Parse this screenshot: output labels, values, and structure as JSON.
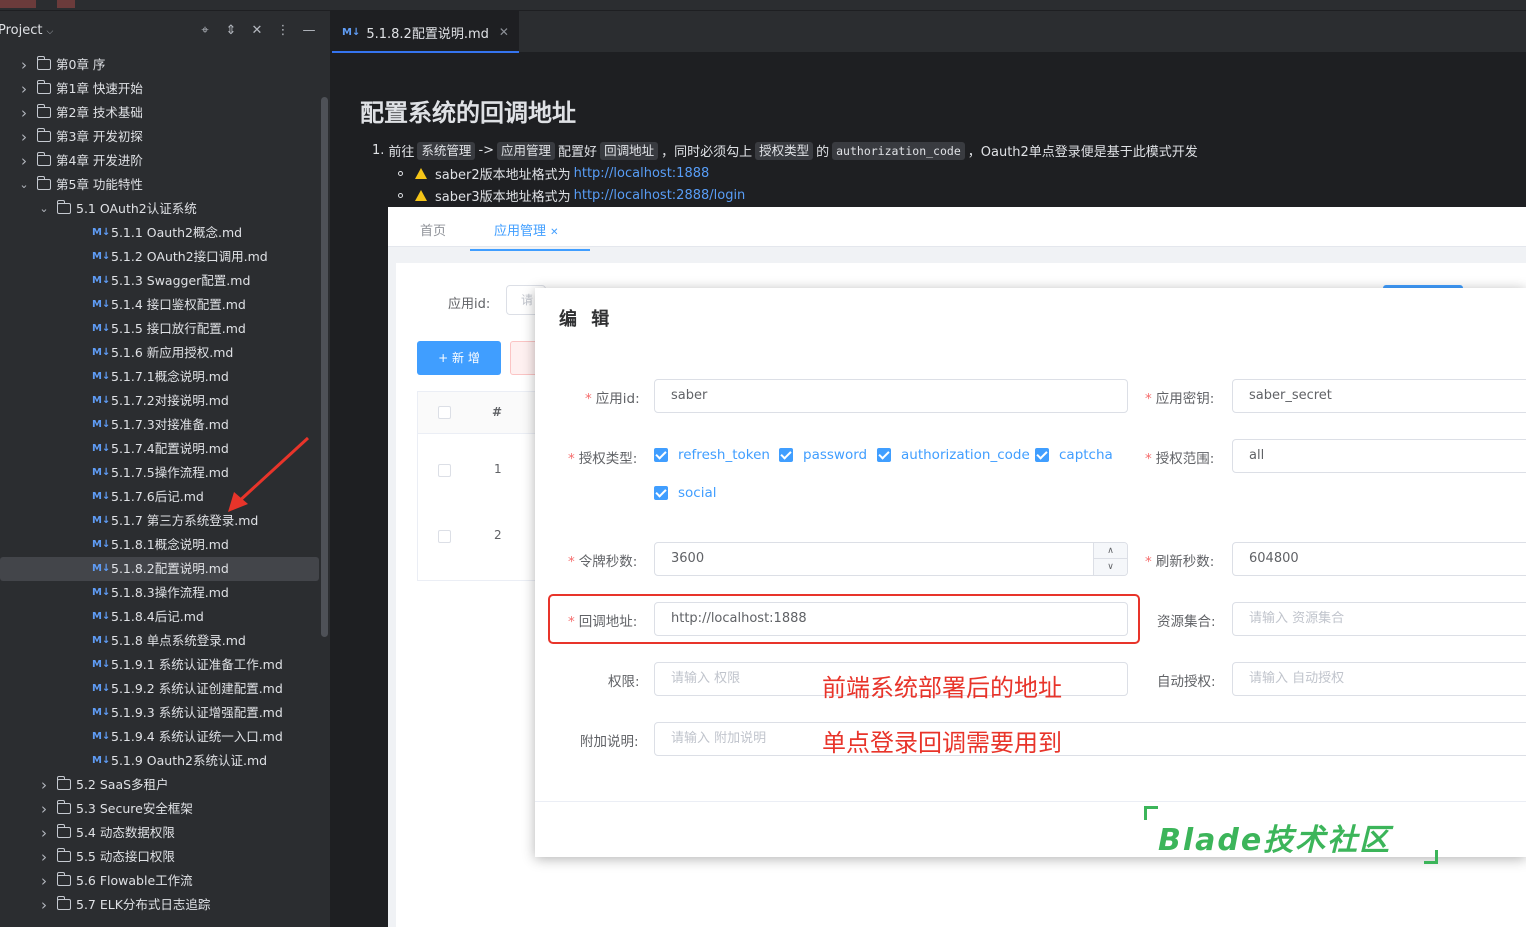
{
  "project": {
    "title": "Project",
    "tree": [
      {
        "label": "第0章 序",
        "type": "folder",
        "depth": 0,
        "expanded": false
      },
      {
        "label": "第1章 快速开始",
        "type": "folder",
        "depth": 0,
        "expanded": false
      },
      {
        "label": "第2章 技术基础",
        "type": "folder",
        "depth": 0,
        "expanded": false
      },
      {
        "label": "第3章 开发初探",
        "type": "folder",
        "depth": 0,
        "expanded": false
      },
      {
        "label": "第4章 开发进阶",
        "type": "folder",
        "depth": 0,
        "expanded": false
      },
      {
        "label": "第5章 功能特性",
        "type": "folder",
        "depth": 0,
        "expanded": true
      },
      {
        "label": "5.1 OAuth2认证系统",
        "type": "folder",
        "depth": 1,
        "expanded": true
      },
      {
        "label": "5.1.1 Oauth2概念.md",
        "type": "md",
        "depth": 2
      },
      {
        "label": "5.1.2 OAuth2接口调用.md",
        "type": "md",
        "depth": 2
      },
      {
        "label": "5.1.3 Swagger配置.md",
        "type": "md",
        "depth": 2
      },
      {
        "label": "5.1.4 接口鉴权配置.md",
        "type": "md",
        "depth": 2
      },
      {
        "label": "5.1.5 接口放行配置.md",
        "type": "md",
        "depth": 2
      },
      {
        "label": "5.1.6 新应用授权.md",
        "type": "md",
        "depth": 2
      },
      {
        "label": "5.1.7.1概念说明.md",
        "type": "md",
        "depth": 2
      },
      {
        "label": "5.1.7.2对接说明.md",
        "type": "md",
        "depth": 2
      },
      {
        "label": "5.1.7.3对接准备.md",
        "type": "md",
        "depth": 2
      },
      {
        "label": "5.1.7.4配置说明.md",
        "type": "md",
        "depth": 2
      },
      {
        "label": "5.1.7.5操作流程.md",
        "type": "md",
        "depth": 2
      },
      {
        "label": "5.1.7.6后记.md",
        "type": "md",
        "depth": 2
      },
      {
        "label": "5.1.7 第三方系统登录.md",
        "type": "md",
        "depth": 2
      },
      {
        "label": "5.1.8.1概念说明.md",
        "type": "md",
        "depth": 2
      },
      {
        "label": "5.1.8.2配置说明.md",
        "type": "md",
        "depth": 2,
        "selected": true
      },
      {
        "label": "5.1.8.3操作流程.md",
        "type": "md",
        "depth": 2
      },
      {
        "label": "5.1.8.4后记.md",
        "type": "md",
        "depth": 2
      },
      {
        "label": "5.1.8 单点系统登录.md",
        "type": "md",
        "depth": 2
      },
      {
        "label": "5.1.9.1 系统认证准备工作.md",
        "type": "md",
        "depth": 2
      },
      {
        "label": "5.1.9.2 系统认证创建配置.md",
        "type": "md",
        "depth": 2
      },
      {
        "label": "5.1.9.3 系统认证增强配置.md",
        "type": "md",
        "depth": 2
      },
      {
        "label": "5.1.9.4 系统认证统一入口.md",
        "type": "md",
        "depth": 2
      },
      {
        "label": "5.1.9 Oauth2系统认证.md",
        "type": "md",
        "depth": 2
      },
      {
        "label": "5.2 SaaS多租户",
        "type": "folder",
        "depth": 1,
        "expanded": false
      },
      {
        "label": "5.3 Secure安全框架",
        "type": "folder",
        "depth": 1,
        "expanded": false
      },
      {
        "label": "5.4 动态数据权限",
        "type": "folder",
        "depth": 1,
        "expanded": false
      },
      {
        "label": "5.5 动态接口权限",
        "type": "folder",
        "depth": 1,
        "expanded": false
      },
      {
        "label": "5.6 Flowable工作流",
        "type": "folder",
        "depth": 1,
        "expanded": false
      },
      {
        "label": "5.7 ELK分布式日志追踪",
        "type": "folder",
        "depth": 1,
        "expanded": false
      }
    ]
  },
  "editor": {
    "tab_label": "5.1.8.2配置说明.md",
    "tab_md_badge": "M↓",
    "heading": "配置系统的回调地址",
    "step1": {
      "num": "1.",
      "t1": "前往",
      "c1": "系统管理",
      "t2": "->",
      "c2": "应用管理",
      "t3": "配置好",
      "c3": "回调地址",
      "t4": "，同时必须勾上",
      "c4": "授权类型",
      "t5": "的",
      "c5": "authorization_code",
      "t6": "，Oauth2单点登录便是基于此模式开发"
    },
    "bullets": [
      {
        "text": "saber2版本地址格式为",
        "link": "http://localhost:1888"
      },
      {
        "text": "saber3版本地址格式为",
        "link": "http://localhost:2888/login"
      }
    ]
  },
  "screenshot": {
    "tabs": [
      "首页",
      "应用管理"
    ],
    "search_label": "应用id:",
    "search_placeholder": "请",
    "add_button": "+ 新 增",
    "table_header": "#",
    "rows": [
      "1",
      "2"
    ]
  },
  "dialog": {
    "title": "编 辑",
    "fields": {
      "app_id_label": "应用id:",
      "app_id_value": "saber",
      "app_secret_label": "应用密钥:",
      "app_secret_value": "saber_secret",
      "grant_type_label": "授权类型:",
      "grant_types": [
        "refresh_token",
        "password",
        "authorization_code",
        "captcha",
        "social"
      ],
      "scope_label": "授权范围:",
      "scope_value": "all",
      "token_label": "令牌秒数:",
      "token_value": "3600",
      "refresh_label": "刷新秒数:",
      "refresh_value": "604800",
      "redirect_label": "回调地址:",
      "redirect_value": "http://localhost:1888",
      "resource_label": "资源集合:",
      "resource_placeholder": "请输入 资源集合",
      "authority_label": "权限:",
      "authority_placeholder": "请输入 权限",
      "autoapprove_label": "自动授权:",
      "autoapprove_placeholder": "请输入 自动授权",
      "extra_label": "附加说明:",
      "extra_placeholder": "请输入 附加说明"
    },
    "annotation1": "前端系统部署后的地址",
    "annotation2": "单点登录回调需要用到"
  },
  "watermark": "Blade技术社区",
  "colors": {
    "accent": "#409eff",
    "annotation": "#e8342a",
    "watermark": "#3cb55a"
  }
}
